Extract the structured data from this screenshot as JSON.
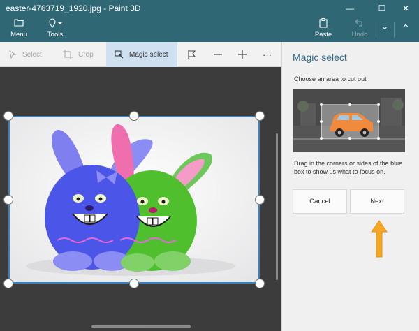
{
  "window": {
    "title": "easter-4763719_1920.jpg - Paint 3D",
    "minimize_glyph": "—",
    "maximize_glyph": "☐",
    "close_glyph": "✕"
  },
  "ribbon": {
    "menu_label": "Menu",
    "tools_label": "Tools",
    "paste_label": "Paste",
    "undo_label": "Undo",
    "more_glyph": "⌄",
    "collapse_glyph": "⌃"
  },
  "toolbar": {
    "select_label": "Select",
    "crop_label": "Crop",
    "magic_select_label": "Magic select",
    "overflow_glyph": "···"
  },
  "panel": {
    "title": "Magic select",
    "subtitle": "Choose an area to cut out",
    "description": "Drag in the corners or sides of the blue box to show us what to focus on.",
    "cancel_label": "Cancel",
    "next_label": "Next"
  },
  "colors": {
    "titlebar": "#2f6775",
    "accent_text": "#2f6b8a",
    "selection": "#3a7fc0",
    "arrow": "#f5a623"
  }
}
